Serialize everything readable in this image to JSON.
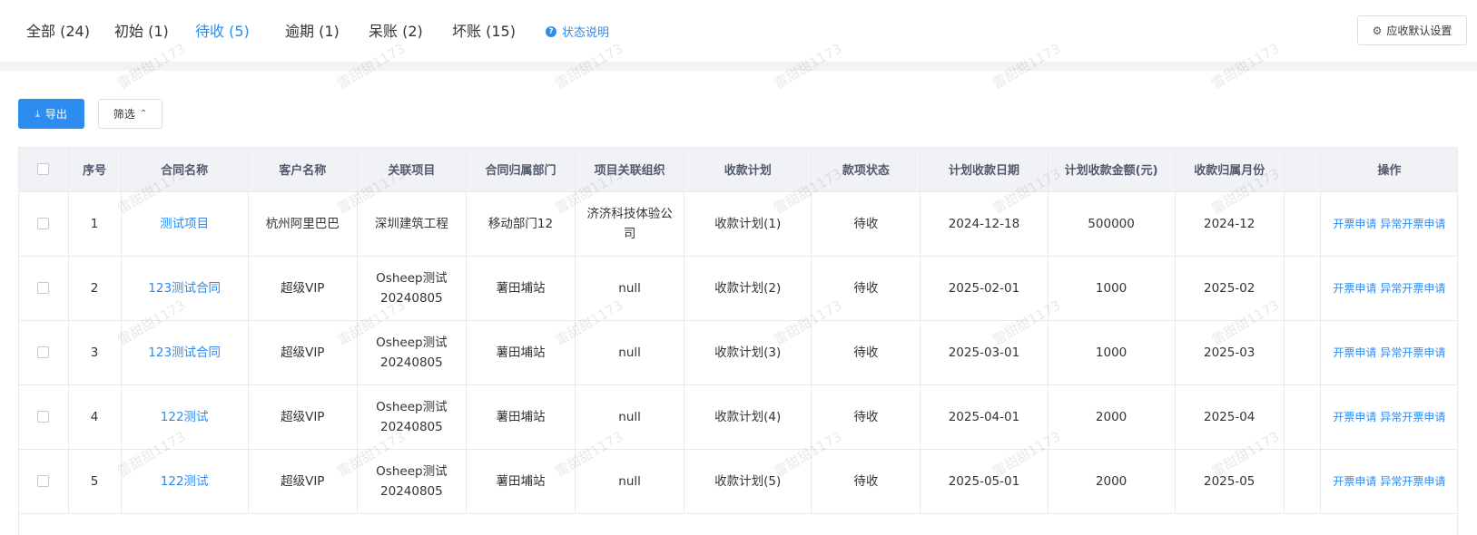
{
  "tabs": [
    {
      "label": "全部 (24)",
      "active": false
    },
    {
      "label": "初始 (1)",
      "active": false
    },
    {
      "label": "待收 (5)",
      "active": true
    },
    {
      "label": "逾期 (1)",
      "active": false
    },
    {
      "label": "呆账 (2)",
      "active": false
    },
    {
      "label": "坏账 (15)",
      "active": false
    }
  ],
  "status_help": {
    "icon": "question-circle-icon",
    "label": "状态说明"
  },
  "settings": {
    "icon": "gear-icon",
    "label": "应收默认设置"
  },
  "toolbar": {
    "export_icon": "download-icon",
    "export_label": "导出",
    "filter_label": "筛选",
    "filter_icon": "chevron-up-icon"
  },
  "table": {
    "headers": [
      "序号",
      "合同名称",
      "客户名称",
      "关联项目",
      "合同归属部门",
      "项目关联组织",
      "收款计划",
      "款项状态",
      "计划收款日期",
      "计划收款金额(元)",
      "收款归属月份",
      "",
      "操作"
    ],
    "rows": [
      {
        "index": "1",
        "contract": "测试项目",
        "customer": "杭州阿里巴巴",
        "project": "深圳建筑工程",
        "dept": "移动部门12",
        "org": "济济科技体验公司",
        "plan": "收款计划(1)",
        "status": "待收",
        "date": "2024-12-18",
        "amount": "500000",
        "month": "2024-12",
        "op1": "开票申请",
        "op2": "异常开票申请"
      },
      {
        "index": "2",
        "contract": "123测试合同",
        "customer": "超级VIP",
        "project": "Osheep测试20240805",
        "dept": "薯田埔站",
        "org": "null",
        "plan": "收款计划(2)",
        "status": "待收",
        "date": "2025-02-01",
        "amount": "1000",
        "month": "2025-02",
        "op1": "开票申请",
        "op2": "异常开票申请"
      },
      {
        "index": "3",
        "contract": "123测试合同",
        "customer": "超级VIP",
        "project": "Osheep测试20240805",
        "dept": "薯田埔站",
        "org": "null",
        "plan": "收款计划(3)",
        "status": "待收",
        "date": "2025-03-01",
        "amount": "1000",
        "month": "2025-03",
        "op1": "开票申请",
        "op2": "异常开票申请"
      },
      {
        "index": "4",
        "contract": "122测试",
        "customer": "超级VIP",
        "project": "Osheep测试20240805",
        "dept": "薯田埔站",
        "org": "null",
        "plan": "收款计划(4)",
        "status": "待收",
        "date": "2025-04-01",
        "amount": "2000",
        "month": "2025-04",
        "op1": "开票申请",
        "op2": "异常开票申请"
      },
      {
        "index": "5",
        "contract": "122测试",
        "customer": "超级VIP",
        "project": "Osheep测试20240805",
        "dept": "薯田埔站",
        "org": "null",
        "plan": "收款计划(5)",
        "status": "待收",
        "date": "2025-05-01",
        "amount": "2000",
        "month": "2025-05",
        "op1": "开票申请",
        "op2": "异常开票申请"
      }
    ]
  },
  "watermark": "雷甜甜1173",
  "colors": {
    "primary": "#2d8cf0",
    "header_bg": "#f0f2f6",
    "border": "#e8eaec"
  }
}
